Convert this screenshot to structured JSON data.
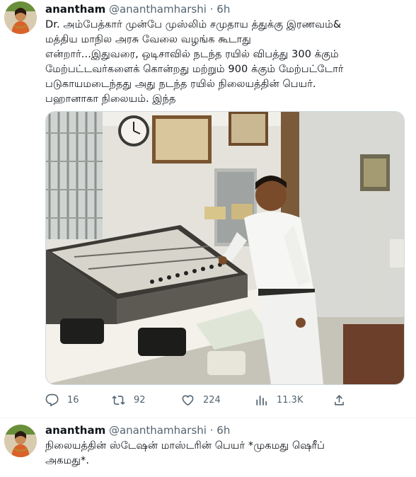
{
  "tweets": [
    {
      "name": "anantham",
      "handle": "@ananthamharshi",
      "separator": "·",
      "time": "6h",
      "text": "Dr. அம்பேத்கார் முன்பே முஸ்லிம் சமுதாய த்துக்கு இரணவம்&\nமத்திய மாநில அரசு வேலை வழங்க கூடாது\nஎன்றார்...இதுவரை, ஒடிசாவில் நடந்த ரயில் விபத்து 300 க்கும்\nமேற்பட்டவர்களைக் கொன்றது மற்றும் 900 க்கும் மேற்பட்டோர்\nபடுகாயமடைந்தது அது நடந்த ரயில் நிலையத்தின் பெயர்.\nபஹானாகா நிலையம். இந்த",
      "actions": {
        "reply_count": "16",
        "retweet_count": "92",
        "like_count": "224",
        "views_count": "11.3K"
      }
    },
    {
      "name": "anantham",
      "handle": "@ananthamharshi",
      "separator": "·",
      "time": "6h",
      "text": "நிலையத்தின் ஸ்டேஷன் மாஸ்டரின் பெயர் *முகமது ஷெரீப்\nஅகமது*."
    }
  ],
  "icons": {
    "reply": "reply-icon",
    "retweet": "retweet-icon",
    "like": "heart-icon",
    "views": "views-icon",
    "share": "share-icon"
  },
  "colors": {
    "icon_gray": "#536471",
    "text": "#0f1419"
  }
}
